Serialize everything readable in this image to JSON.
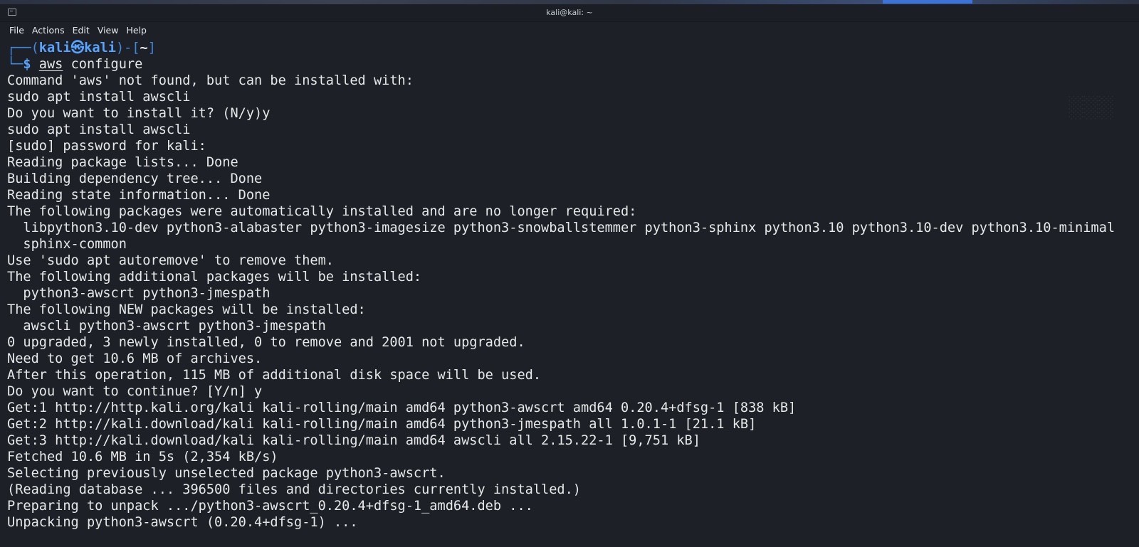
{
  "window": {
    "title": "kali@kali: ~",
    "icon": "terminal-icon"
  },
  "menubar": {
    "items": [
      "File",
      "Actions",
      "Edit",
      "View",
      "Help"
    ]
  },
  "prompt": {
    "open_bracket": "┌──(",
    "user": "kali",
    "at_symbol": "㉿",
    "host": "kali",
    "mid": ")-[",
    "cwd": "~",
    "close": "]",
    "corner": "└─",
    "dollar": "$",
    "command": "aws",
    "args": " configure"
  },
  "output": [
    "Command 'aws' not found, but can be installed with:",
    "sudo apt install awscli",
    "Do you want to install it? (N/y)y",
    "sudo apt install awscli",
    "[sudo] password for kali:",
    "Reading package lists... Done",
    "Building dependency tree... Done",
    "Reading state information... Done",
    "The following packages were automatically installed and are no longer required:",
    "  libpython3.10-dev python3-alabaster python3-imagesize python3-snowballstemmer python3-sphinx python3.10 python3.10-dev python3.10-minimal",
    "  sphinx-common",
    "Use 'sudo apt autoremove' to remove them.",
    "The following additional packages will be installed:",
    "  python3-awscrt python3-jmespath",
    "The following NEW packages will be installed:",
    "  awscli python3-awscrt python3-jmespath",
    "0 upgraded, 3 newly installed, 0 to remove and 2001 not upgraded.",
    "Need to get 10.6 MB of archives.",
    "After this operation, 115 MB of additional disk space will be used.",
    "Do you want to continue? [Y/n] y",
    "Get:1 http://http.kali.org/kali kali-rolling/main amd64 python3-awscrt amd64 0.20.4+dfsg-1 [838 kB]",
    "Get:2 http://kali.download/kali kali-rolling/main amd64 python3-jmespath all 1.0.1-1 [21.1 kB]",
    "Get:3 http://kali.download/kali kali-rolling/main amd64 awscli all 2.15.22-1 [9,751 kB]",
    "Fetched 10.6 MB in 5s (2,354 kB/s)",
    "Selecting previously unselected package python3-awscrt.",
    "(Reading database ... 396500 files and directories currently installed.)",
    "Preparing to unpack .../python3-awscrt_0.20.4+dfsg-1_amd64.deb ...",
    "Unpacking python3-awscrt (0.20.4+dfsg-1) ..."
  ]
}
